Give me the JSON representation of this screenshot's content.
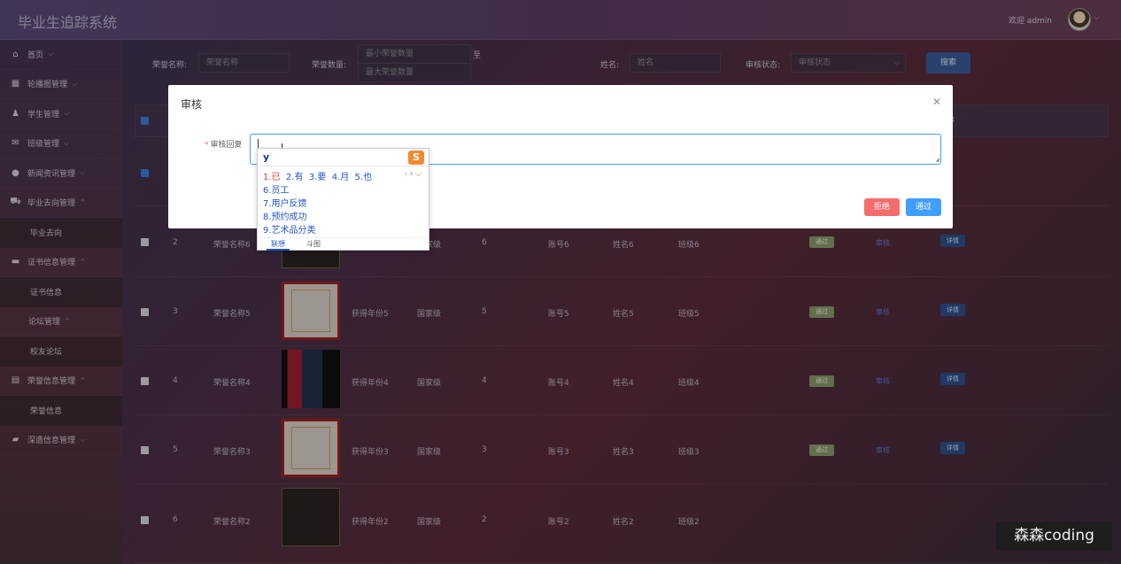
{
  "header": {
    "app_title": "毕业生追踪系统",
    "welcome": "欢迎 admin"
  },
  "sidebar": {
    "items": [
      {
        "label": "首页",
        "icon": "home-icon"
      },
      {
        "label": "轮播图管理",
        "icon": "dashboard-icon"
      },
      {
        "label": "学生管理",
        "icon": "user-icon"
      },
      {
        "label": "班级管理",
        "icon": "mail-icon"
      },
      {
        "label": "新闻资讯管理",
        "icon": "news-icon"
      },
      {
        "label": "毕业去向管理",
        "icon": "car-icon",
        "sub": "毕业去向"
      },
      {
        "label": "证书信息管理",
        "icon": "cert-icon",
        "sub": "证书信息"
      },
      {
        "label": "论坛管理",
        "icon": "",
        "sub": "校友论坛"
      },
      {
        "label": "荣誉信息管理",
        "icon": "honor-icon",
        "sub": "荣誉信息"
      },
      {
        "label": "深造信息管理",
        "icon": "study-icon"
      }
    ]
  },
  "search": {
    "honor_name_label": "荣誉名称:",
    "honor_name_placeholder": "荣誉名称",
    "honor_count_label": "荣誉数量:",
    "min_placeholder": "最小荣誉数量",
    "max_placeholder": "最大荣誉数量",
    "range_sep": "至",
    "name_label": "姓名:",
    "name_placeholder": "姓名",
    "status_label": "审核状态:",
    "status_placeholder": "审核状态",
    "search_button": "搜索"
  },
  "table": {
    "rows": [
      {
        "no": "2",
        "name": "荣誉名称6",
        "year": "",
        "level": "国家级",
        "count": "6",
        "account": "账号6",
        "person": "姓名6",
        "cls": "班级6",
        "status": "通过",
        "review": "审核",
        "detail": "详情"
      },
      {
        "no": "3",
        "name": "荣誉名称5",
        "year": "获得年份5",
        "level": "国家级",
        "count": "5",
        "account": "账号5",
        "person": "姓名5",
        "cls": "班级5",
        "status": "通过",
        "review": "审核",
        "detail": "详情"
      },
      {
        "no": "4",
        "name": "荣誉名称4",
        "year": "获得年份4",
        "level": "国家级",
        "count": "4",
        "account": "账号4",
        "person": "姓名4",
        "cls": "班级4",
        "status": "通过",
        "review": "审核",
        "detail": "详情"
      },
      {
        "no": "5",
        "name": "荣誉名称3",
        "year": "获得年份3",
        "level": "国家级",
        "count": "3",
        "account": "账号3",
        "person": "姓名3",
        "cls": "班级3",
        "status": "通过",
        "review": "审核",
        "detail": "详情"
      },
      {
        "no": "6",
        "name": "荣誉名称2",
        "year": "获得年份2",
        "level": "国家级",
        "count": "2",
        "account": "账号2",
        "person": "姓名2",
        "cls": "班级2",
        "status": "",
        "review": "",
        "detail": ""
      }
    ],
    "sort_icon": "⇕"
  },
  "dialog": {
    "title": "审核",
    "field_label": "审核回复",
    "reject_button": "拒绝",
    "pass_button": "通过"
  },
  "ime": {
    "composition": "y",
    "candidates": [
      "1.已",
      "2.有",
      "3.要",
      "4.月",
      "5.也"
    ],
    "more": [
      "6.员工",
      "7.用户反馈",
      "8.预约成功",
      "9.艺术品分类"
    ],
    "tab_assoc": "联想",
    "tab_emoji": "斗图"
  },
  "watermark": "森森coding"
}
